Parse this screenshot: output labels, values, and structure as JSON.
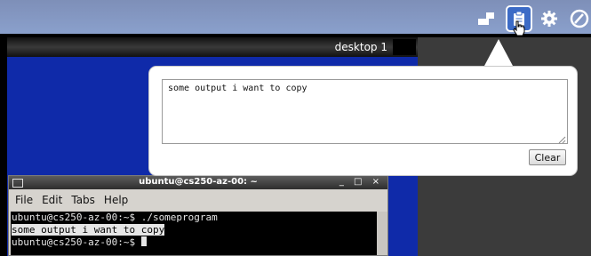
{
  "toolbar": {
    "buttons": [
      {
        "name": "screen-icon"
      },
      {
        "name": "clipboard-icon",
        "active": true
      },
      {
        "name": "gear-icon"
      },
      {
        "name": "power-icon"
      }
    ],
    "accent": "#3c6bc6"
  },
  "desktop": {
    "label": "desktop 1",
    "background": "#0f2aa9"
  },
  "clipboard_panel": {
    "text": "some output i want to copy",
    "clear_label": "Clear"
  },
  "terminal": {
    "title": "ubuntu@cs250-az-00: ~",
    "controls": "_ □ ×",
    "menu": [
      "File",
      "Edit",
      "Tabs",
      "Help"
    ],
    "lines": {
      "line1": "ubuntu@cs250-az-00:~$ ./someprogram",
      "line2": "some output i want to copy",
      "line3": "ubuntu@cs250-az-00:~$ "
    }
  }
}
